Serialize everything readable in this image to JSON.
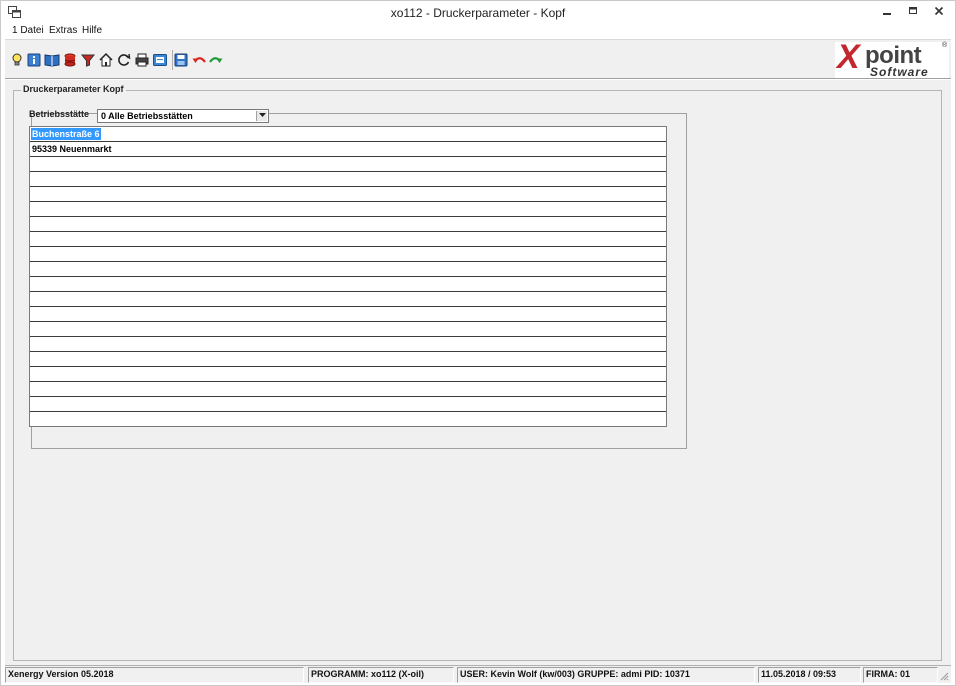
{
  "window": {
    "title": "xo112 - Druckerparameter - Kopf",
    "app_icon": "window-restore-icon"
  },
  "menu": [
    "1 Datei",
    "Extras",
    "Hilfe"
  ],
  "toolbar": {
    "icons": [
      "lightbulb-icon",
      "info-book-icon",
      "open-book-icon",
      "database-icon",
      "filter-icon",
      "home-icon",
      "refresh-icon",
      "printer-icon",
      "screen-icon",
      "save-icon",
      "undo-icon",
      "redo-icon"
    ]
  },
  "logo": {
    "x": "X",
    "point": "point",
    "software": "Software",
    "reg": "®",
    "colors": {
      "red": "#c2282d",
      "gray": "#444444"
    }
  },
  "form": {
    "group_title": "Druckerparameter Kopf",
    "betriebsstaette_label": "Betriebsstätte",
    "betriebsstaette_value": "0 Alle Betriebsstätten",
    "rows": [
      "Buchenstraße 6",
      "95339 Neuenmarkt",
      "",
      "",
      "",
      "",
      "",
      "",
      "",
      "",
      "",
      "",
      "",
      "",
      "",
      "",
      "",
      "",
      "",
      ""
    ],
    "selected_row": 0
  },
  "status": {
    "version": "Xenergy Version 05.2018",
    "program": "PROGRAMM: xo112 (X-oil)",
    "user": "USER: Kevin Wolf (kw/003)  GRUPPE: admi  PID: 10371",
    "datetime": "11.05.2018 / 09:53",
    "firma": "FIRMA: 01"
  }
}
